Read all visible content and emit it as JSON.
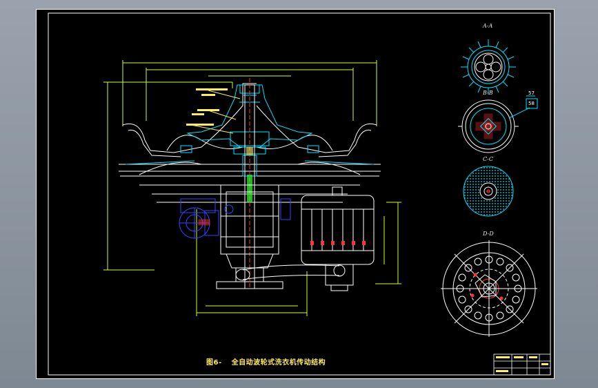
{
  "caption": {
    "figure_no": "图6-",
    "title": "全自动波轮式洗衣机传动结构"
  },
  "section_views": [
    {
      "label": "A-A"
    },
    {
      "label": "B-B"
    },
    {
      "label": "C-C"
    },
    {
      "label": "D-D"
    }
  ],
  "balloons": [
    "57",
    "58"
  ],
  "colors": {
    "sheet": "#000000",
    "frame": "#ffffff",
    "structure": "#ffffff",
    "section": "#00e5ff",
    "dimension": "#ccff33",
    "hidden": "#3344ff",
    "annotation": "#ffee55",
    "accent_red": "#ff3333",
    "accent_green": "#33ff33"
  }
}
